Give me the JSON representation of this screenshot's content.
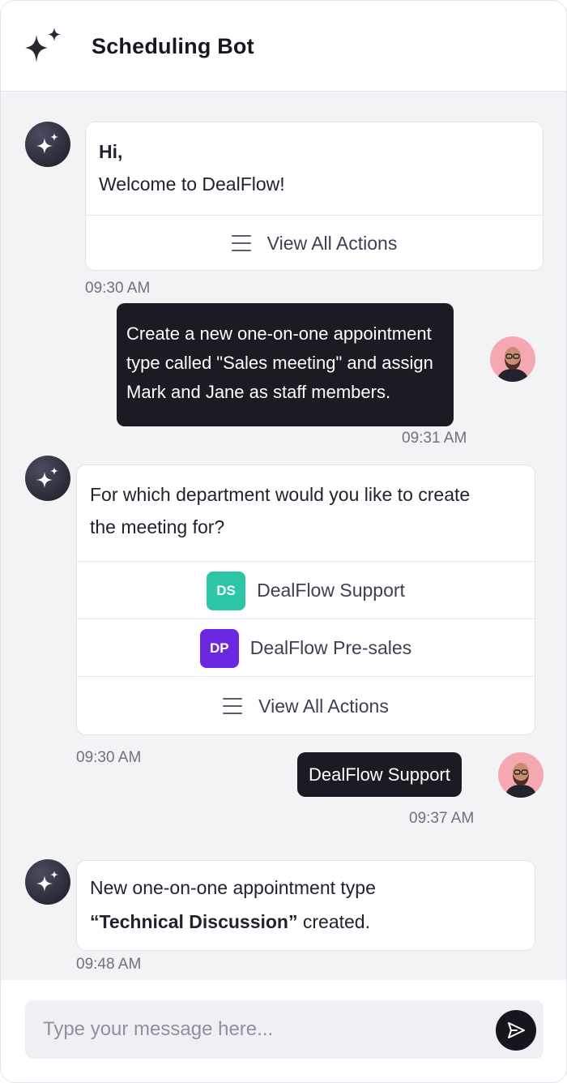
{
  "header": {
    "title": "Scheduling Bot",
    "logo_icon": "sparkle-icon"
  },
  "conversation": {
    "bot_greeting": {
      "line1": "Hi,",
      "line2": "Welcome to DealFlow!",
      "action_label": "View All Actions",
      "time": "09:30 AM"
    },
    "user_request": {
      "lines": [
        "Create a new one-on-one appointment",
        "type called \"Sales meeting\" and assign",
        "Mark and Jane as staff members."
      ],
      "time": "09:31 AM"
    },
    "bot_question": {
      "line1": "For which department would you like to create",
      "line2": "the meeting for?",
      "options": [
        {
          "badge": "DS",
          "label": "DealFlow Support",
          "color": "#2cc5a6"
        },
        {
          "badge": "DP",
          "label": "DealFlow Pre-sales",
          "color": "#6c27e0"
        }
      ],
      "action_label": "View All Actions",
      "time": "09:30 AM"
    },
    "user_reply": {
      "text": "DealFlow Support",
      "time": "09:37 AM"
    },
    "bot_confirmation": {
      "line1": "New one-on-one appointment type",
      "line2_bold": "“Technical Discussion”",
      "line2_rest": " created.",
      "time": "09:48 AM"
    }
  },
  "composer": {
    "placeholder": "Type your message here...",
    "send_icon": "send-icon"
  },
  "colors": {
    "background": "#f3f3f6",
    "user_bubble": "#1b1b24",
    "bot_avatar": "#2d2f3b"
  }
}
